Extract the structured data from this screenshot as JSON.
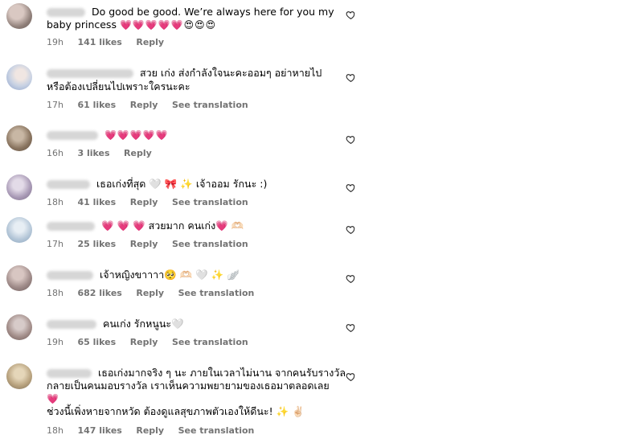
{
  "comments": [
    {
      "text": "Do good be good. We’re always here for you my",
      "text2": "baby princess",
      "emoji": "💗💗💗💗💗😍😍😍",
      "time": "19h",
      "likes": "141 likes",
      "reply": "Reply",
      "translate": ""
    },
    {
      "text": "สวย เก่ง ส่งกำลังใจนะคะออมๆ อย่าหายไป",
      "text2": "หรือต้องเปลี่ยนไปเพราะใครนะคะ",
      "emoji": "",
      "time": "17h",
      "likes": "61 likes",
      "reply": "Reply",
      "translate": "See translation"
    },
    {
      "text": "",
      "text2": "",
      "emoji": "💗💗💗💗💗",
      "time": "16h",
      "likes": "3 likes",
      "reply": "Reply",
      "translate": ""
    },
    {
      "text": "เธอเก่งที่สุด 🤍 🎀 ✨ เจ้าออม รักนะ :)",
      "text2": "",
      "emoji": "",
      "time": "18h",
      "likes": "41 likes",
      "reply": "Reply",
      "translate": "See translation"
    },
    {
      "text": "💗 💗 💗 สวยมาก คนเก่ง💗 🫶🏻",
      "text2": "",
      "emoji": "",
      "time": "17h",
      "likes": "25 likes",
      "reply": "Reply",
      "translate": "See translation"
    },
    {
      "text": "เจ้าหญิงขาาาา🥺 🫶🏻 🤍 ✨ 🪽",
      "text2": "",
      "emoji": "",
      "time": "18h",
      "likes": "682 likes",
      "reply": "Reply",
      "translate": "See translation"
    },
    {
      "text": "คนเก่ง รักหนูนะ🤍",
      "text2": "",
      "emoji": "",
      "time": "19h",
      "likes": "65 likes",
      "reply": "Reply",
      "translate": "See translation"
    },
    {
      "text": "เธอเก่งมากจริง ๆ นะ ภายในเวลาไม่นาน จากคนรับรางวัล",
      "text2": "กลายเป็นคนมอบรางวัล เราเห็นความพยายามของเธอมาตลอดเลย",
      "text3": "💗",
      "text4": "ช่วงนี้เพิ่งหายจากหวัด ต้องดูแลสุขภาพตัวเองให้ดีนะ! ✨ ✌🏻",
      "time": "18h",
      "likes": "147 likes",
      "reply": "Reply",
      "translate": "See translation"
    }
  ],
  "icons": {
    "like": "heart-outline-icon"
  }
}
